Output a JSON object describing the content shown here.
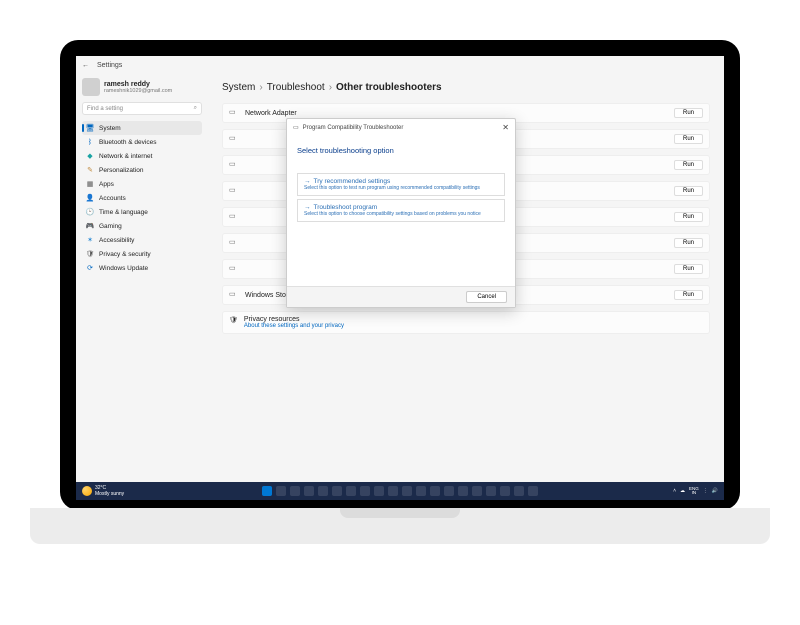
{
  "window": {
    "back_label": "←",
    "title": "Settings"
  },
  "user": {
    "name": "ramesh reddy",
    "email": "rameshnik1029@gmail.com"
  },
  "search": {
    "placeholder": "Find a setting",
    "icon": "search-icon"
  },
  "sidebar": {
    "items": [
      {
        "label": "System",
        "icon": "🖥",
        "color": "#0067c0",
        "active": true
      },
      {
        "label": "Bluetooth & devices",
        "icon": "ᛒ",
        "color": "#0067c0"
      },
      {
        "label": "Network & internet",
        "icon": "◆",
        "color": "#1aa3a3"
      },
      {
        "label": "Personalization",
        "icon": "✎",
        "color": "#c08a3e"
      },
      {
        "label": "Apps",
        "icon": "▦",
        "color": "#555"
      },
      {
        "label": "Accounts",
        "icon": "👤",
        "color": "#2b8a3e"
      },
      {
        "label": "Time & language",
        "icon": "🕑",
        "color": "#6a4ca0"
      },
      {
        "label": "Gaming",
        "icon": "🎮",
        "color": "#777"
      },
      {
        "label": "Accessibility",
        "icon": "✶",
        "color": "#2b8ad4"
      },
      {
        "label": "Privacy & security",
        "icon": "🛡",
        "color": "#555"
      },
      {
        "label": "Windows Update",
        "icon": "⟳",
        "color": "#0067c0"
      }
    ]
  },
  "breadcrumb": {
    "a": "System",
    "b": "Troubleshoot",
    "c": "Other troubleshooters",
    "sep": "›"
  },
  "troubleshooters": {
    "run_label": "Run",
    "rows": [
      {
        "label": "Network Adapter"
      },
      {
        "label": ""
      },
      {
        "label": ""
      },
      {
        "label": ""
      },
      {
        "label": ""
      },
      {
        "label": ""
      },
      {
        "label": ""
      },
      {
        "label": "Windows Store Apps"
      }
    ]
  },
  "privacy": {
    "title": "Privacy resources",
    "link": "About these settings and your privacy"
  },
  "dialog": {
    "title": "Program Compatibility Troubleshooter",
    "heading": "Select troubleshooting option",
    "options": [
      {
        "title": "Try recommended settings",
        "desc": "Select this option to test run program using recommended compatibility settings"
      },
      {
        "title": "Troubleshoot program",
        "desc": "Select this option to choose compatibility settings based on problems you notice"
      }
    ],
    "cancel": "Cancel",
    "close": "✕",
    "arrow": "→"
  },
  "taskbar": {
    "weather_temp": "32°C",
    "weather_desc": "Mostly sunny",
    "lang_top": "ENG",
    "lang_bot": "IN"
  }
}
